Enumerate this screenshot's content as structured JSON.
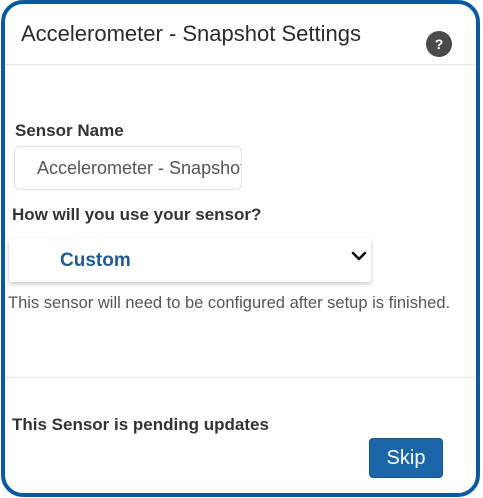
{
  "header": {
    "title": "Accelerometer - Snapshot Settings",
    "help_glyph": "?"
  },
  "form": {
    "sensor_name_label": "Sensor Name",
    "sensor_name_value": "Accelerometer - Snapshot",
    "usage_label": "How will you use your sensor?",
    "usage_selected": "Custom",
    "helper_text": "This sensor will need to be configured after setup is finished."
  },
  "footer": {
    "pending_text": "This Sensor is pending updates",
    "skip_label": "Skip"
  },
  "colors": {
    "frame_border": "#0a5aa0",
    "accent_text": "#1f5c93",
    "button_bg": "#1a66a8"
  },
  "icons": {
    "help": "help-icon",
    "dropdown": "chevron-down-icon"
  }
}
